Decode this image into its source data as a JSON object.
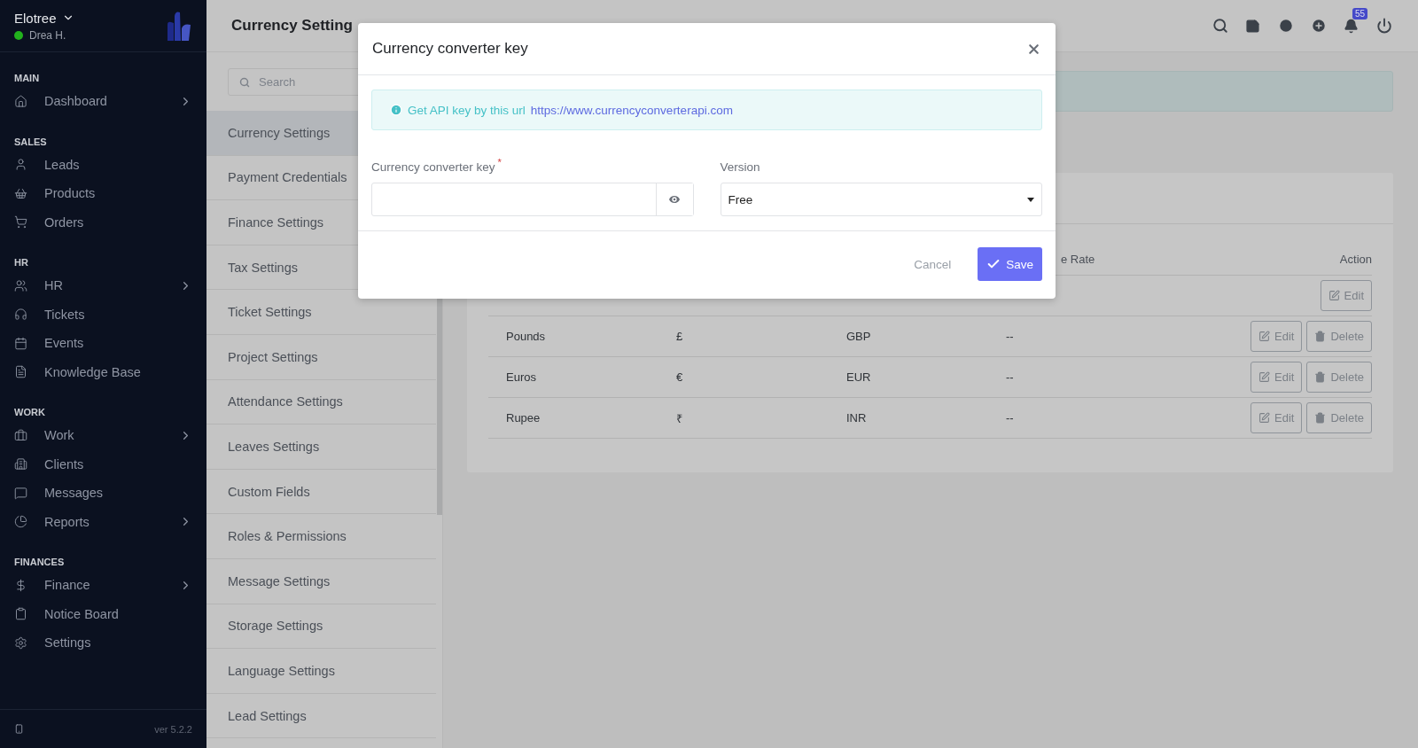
{
  "sidebar": {
    "company": "Elotree",
    "user": {
      "name": "Drea H.",
      "online": true
    },
    "sections": [
      {
        "title": "MAIN",
        "items": [
          {
            "label": "Dashboard",
            "expandable": true
          }
        ]
      },
      {
        "title": "SALES",
        "items": [
          {
            "label": "Leads",
            "expandable": false
          },
          {
            "label": "Products",
            "expandable": false
          },
          {
            "label": "Orders",
            "expandable": false
          }
        ]
      },
      {
        "title": "HR",
        "items": [
          {
            "label": "HR",
            "expandable": true
          },
          {
            "label": "Tickets",
            "expandable": false
          },
          {
            "label": "Events",
            "expandable": false
          },
          {
            "label": "Knowledge Base",
            "expandable": false
          }
        ]
      },
      {
        "title": "WORK",
        "items": [
          {
            "label": "Work",
            "expandable": true
          },
          {
            "label": "Clients",
            "expandable": false
          },
          {
            "label": "Messages",
            "expandable": false
          },
          {
            "label": "Reports",
            "expandable": true
          }
        ]
      },
      {
        "title": "FINANCES",
        "items": [
          {
            "label": "Finance",
            "expandable": true
          },
          {
            "label": "Notice Board",
            "expandable": false
          },
          {
            "label": "Settings",
            "expandable": false
          }
        ]
      }
    ],
    "version": "ver 5.2.2"
  },
  "header": {
    "title": "Currency Setting",
    "notification_count": "55"
  },
  "settings_menu": {
    "search_placeholder": "Search",
    "items": [
      {
        "label": "Currency Settings",
        "selected": true
      },
      {
        "label": "Payment Credentials",
        "selected": false
      },
      {
        "label": "Finance Settings",
        "selected": false
      },
      {
        "label": "Tax Settings",
        "selected": false
      },
      {
        "label": "Ticket Settings",
        "selected": false
      },
      {
        "label": "Project Settings",
        "selected": false
      },
      {
        "label": "Attendance Settings",
        "selected": false
      },
      {
        "label": "Leaves Settings",
        "selected": false
      },
      {
        "label": "Custom Fields",
        "selected": false
      },
      {
        "label": "Roles & Permissions",
        "selected": false
      },
      {
        "label": "Message Settings",
        "selected": false
      },
      {
        "label": "Storage Settings",
        "selected": false
      },
      {
        "label": "Language Settings",
        "selected": false
      },
      {
        "label": "Lead Settings",
        "selected": false
      }
    ]
  },
  "currency_table": {
    "header": {
      "column_4": "e Rate",
      "action": "Action"
    },
    "rows": [
      {
        "actions": [
          "Edit"
        ]
      },
      {
        "name": "Pounds",
        "symbol": "£",
        "code": "GBP",
        "rate": "--",
        "actions": [
          "Edit",
          "Delete"
        ]
      },
      {
        "name": "Euros",
        "symbol": "€",
        "code": "EUR",
        "rate": "--",
        "actions": [
          "Edit",
          "Delete"
        ]
      },
      {
        "name": "Rupee",
        "symbol": "₹",
        "code": "INR",
        "rate": "--",
        "actions": [
          "Edit",
          "Delete"
        ]
      }
    ]
  },
  "modal": {
    "title": "Currency converter key",
    "info": "Get API key by this url",
    "link": "https://www.currencyconverterapi.com",
    "fields": [
      {
        "kind": "password",
        "label": "Currency converter key",
        "required_mark": "*"
      },
      {
        "kind": "select",
        "label": "Version",
        "value": "Free"
      }
    ],
    "cancel": "Cancel",
    "save": "Save"
  }
}
